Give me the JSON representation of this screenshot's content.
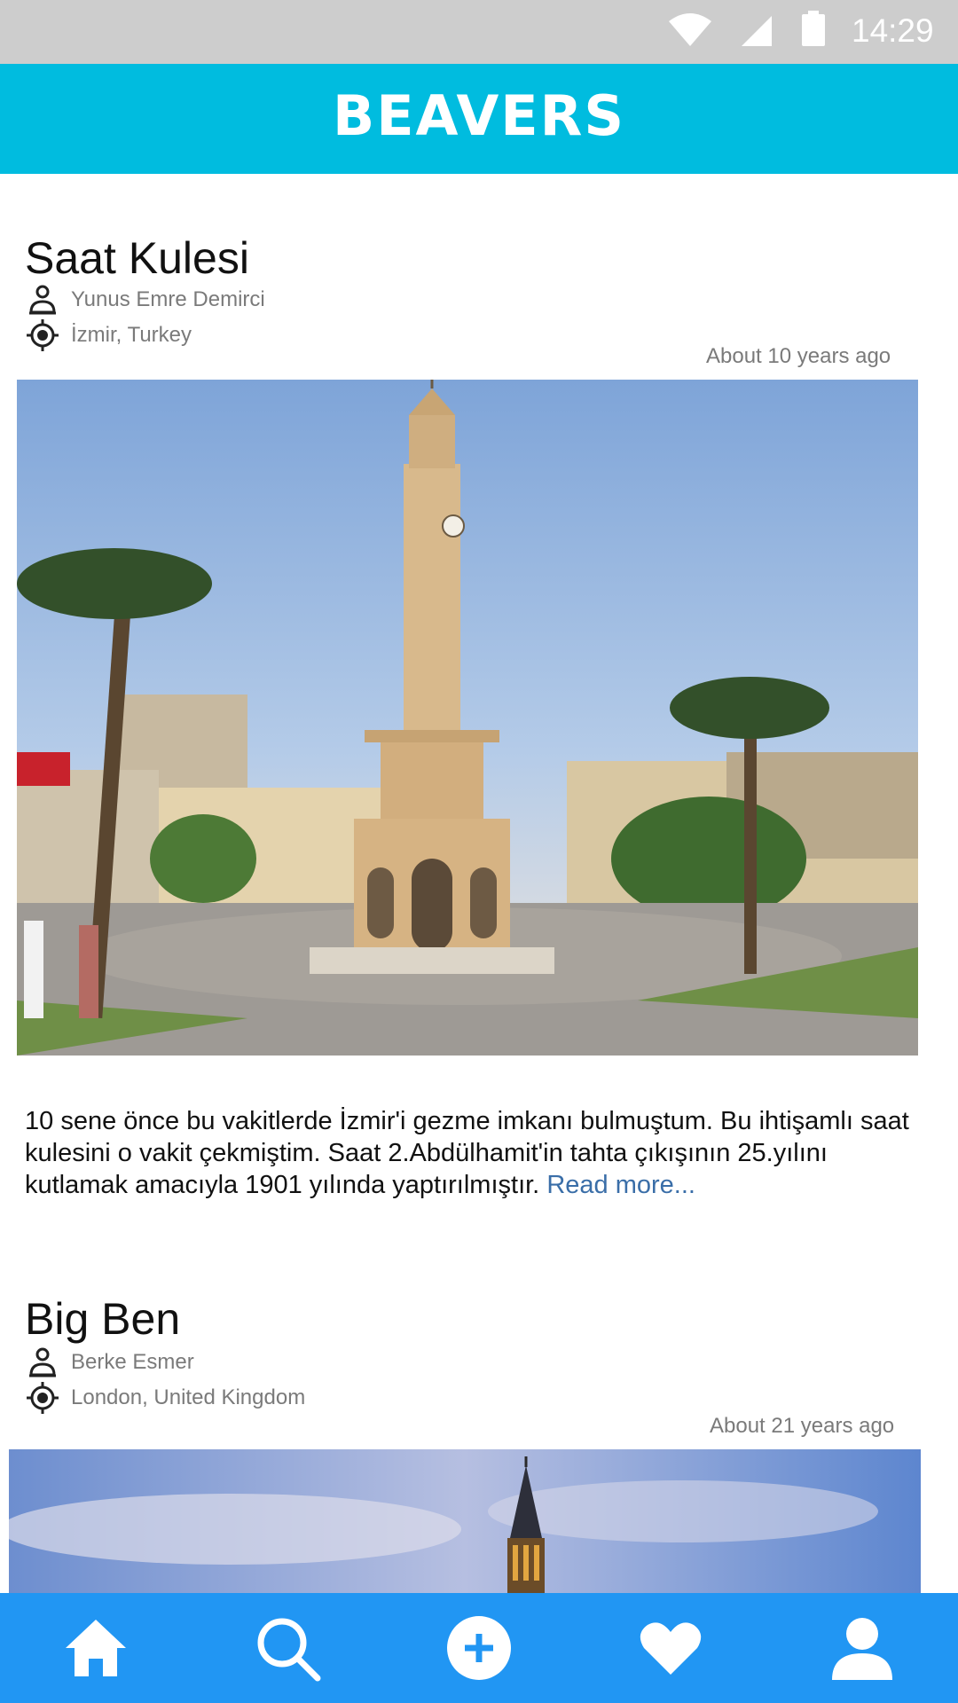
{
  "status_bar": {
    "time": "14:29",
    "icons": [
      "wifi-icon",
      "signal-icon",
      "battery-icon"
    ]
  },
  "app_bar": {
    "title": "BEAVERS",
    "color": "#00bcdf"
  },
  "posts": [
    {
      "title": "Saat Kulesi",
      "author": "Yunus Emre Demirci",
      "location": "İzmir, Turkey",
      "time_ago": "About 10 years ago",
      "photo": "clock-tower-photo",
      "body": "10 sene önce bu vakitlerde İzmir'i gezme imkanı bulmuştum. Bu ihtişamlı saat kulesini o vakit çekmiştim. Saat 2.Abdülhamit'in tahta çıkışının 25.yılını kutlamak amacıyla 1901 yılında yaptırılmıştır.",
      "read_more": "Read more..."
    },
    {
      "title": "Big Ben",
      "author": "Berke Esmer",
      "location": "London, United Kingdom",
      "time_ago": "About 21 years ago",
      "photo": "big-ben-photo"
    }
  ],
  "bottom_nav": {
    "color": "#2196f3",
    "items": [
      "home-icon",
      "search-icon",
      "add-icon",
      "favorites-icon",
      "profile-icon"
    ]
  }
}
